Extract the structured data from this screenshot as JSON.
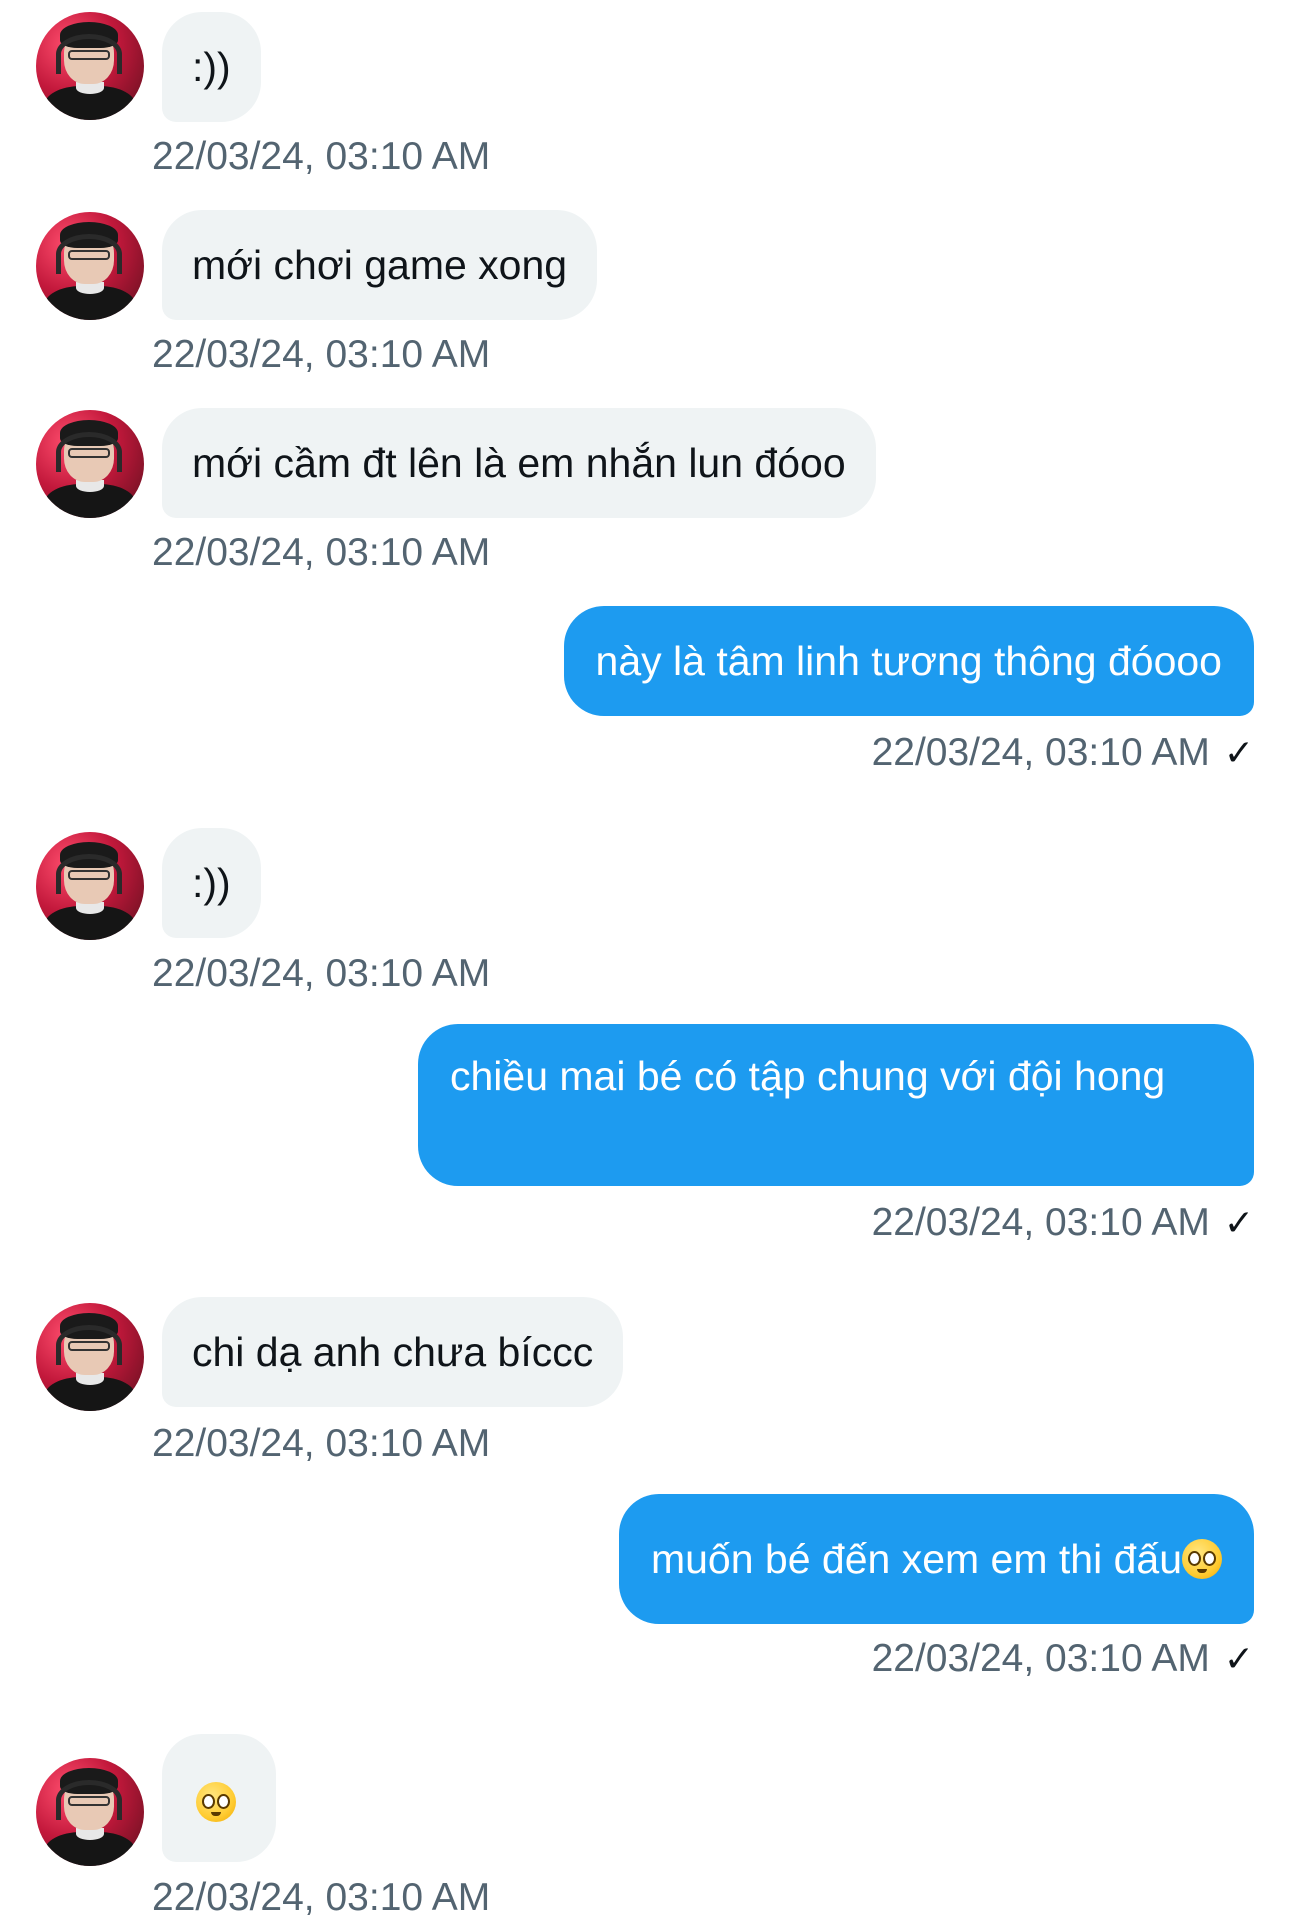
{
  "messages": [
    {
      "dir": "in",
      "text": ":))",
      "time": "22/03/24, 03:10 AM"
    },
    {
      "dir": "in",
      "text": "mới chơi game xong",
      "time": "22/03/24, 03:10 AM"
    },
    {
      "dir": "in",
      "text": "mới cầm đt lên là em nhắn lun đóoo",
      "time": "22/03/24, 03:10 AM"
    },
    {
      "dir": "out",
      "text": "này là tâm linh tương thông đóooo",
      "time": "22/03/24, 03:10 AM",
      "status_icon": "check-icon"
    },
    {
      "dir": "in",
      "text": ":))",
      "time": "22/03/24, 03:10 AM"
    },
    {
      "dir": "out",
      "text": "chiều mai bé có tập chung với đội hong",
      "time": "22/03/24, 03:10 AM",
      "status_icon": "check-icon"
    },
    {
      "dir": "in",
      "text": "chi dạ anh chưa bíccc",
      "time": "22/03/24, 03:10 AM"
    },
    {
      "dir": "out",
      "text": "muốn bé đến xem em thi đấu",
      "emoji": "pleading-face-emoji",
      "time": "22/03/24, 03:10 AM",
      "status_icon": "check-icon"
    },
    {
      "dir": "in",
      "text": "",
      "emoji": "pleading-face-emoji",
      "time": "22/03/24, 03:10 AM"
    }
  ],
  "colors": {
    "incoming_bubble": "#eff3f4",
    "outgoing_bubble": "#1d9bf0",
    "timestamp": "#536471"
  },
  "icons": {
    "sent_check": "✓"
  }
}
